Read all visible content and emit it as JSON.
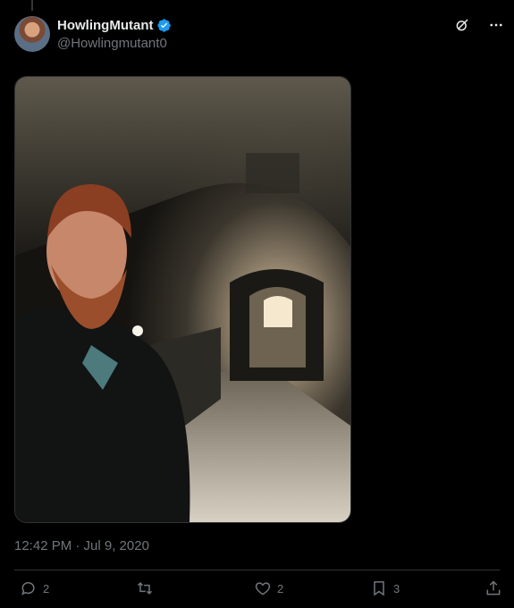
{
  "author": {
    "display_name": "HowlingMutant",
    "handle": "@Howlingmutant0",
    "verified": true
  },
  "tweet": {
    "timestamp": "12:42 PM · Jul 9, 2020"
  },
  "media": {
    "alt": "Selfie of a red-haired bearded man in a dark jacket inside a stone tunnel with a cobblestone floor and an illuminated archway behind him"
  },
  "actions": {
    "reply_count": "2",
    "retweet_count": "",
    "like_count": "2",
    "bookmark_count": "3"
  },
  "icons": {
    "grok": "grok-icon",
    "more": "more-icon",
    "reply": "reply-icon",
    "retweet": "retweet-icon",
    "like": "heart-icon",
    "bookmark": "bookmark-icon",
    "share": "share-icon"
  },
  "colors": {
    "background": "#000000",
    "text": "#e7e9ea",
    "muted": "#71767b",
    "verified": "#1d9bf0",
    "border": "#2f3336"
  }
}
